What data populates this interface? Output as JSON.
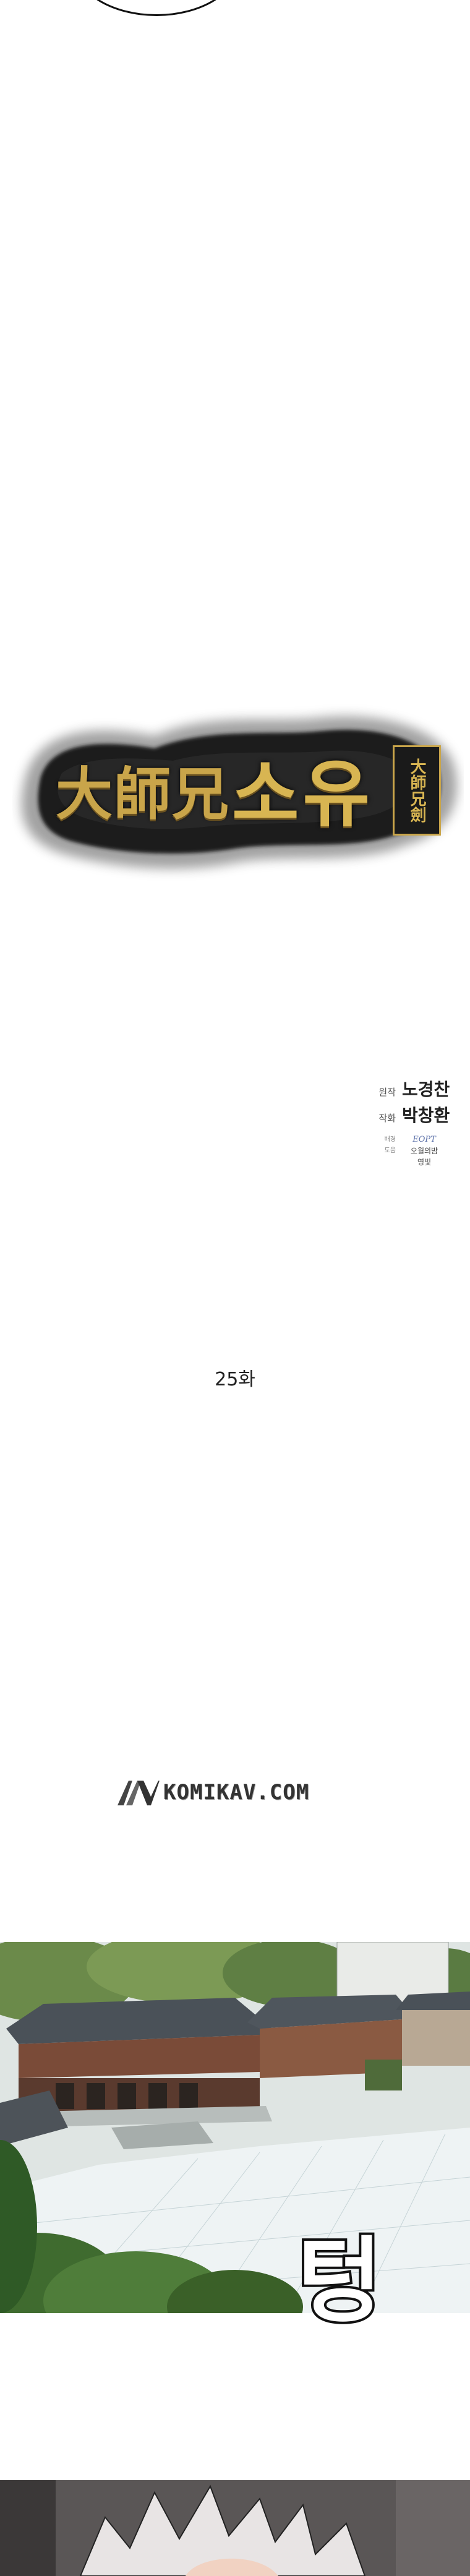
{
  "title_logo": {
    "hanja": "大師兄",
    "hangul": "소유",
    "seal": "大師兄劍"
  },
  "credits": {
    "original_label": "원작",
    "original_name": "노경찬",
    "art_label": "작화",
    "art_name": "박창환",
    "bg_label": "배경",
    "bg_name": "EOPT",
    "assist_label": "도움",
    "assist_names": "오월의밤",
    "assist_names2": "영빛"
  },
  "episode": "25화",
  "watermark": "KOMIKAV.COM",
  "sfx_text": "텅",
  "colors": {
    "gold": "#c9a54a",
    "ink": "#111111"
  }
}
